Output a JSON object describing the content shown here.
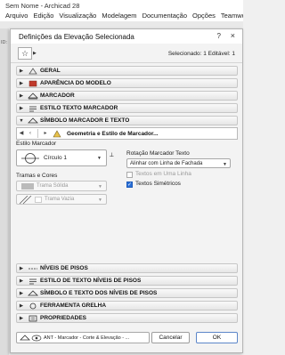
{
  "app": {
    "title": "Sem Nome - Archicad 28",
    "menu": [
      "Arquivo",
      "Edição",
      "Visualização",
      "Modelagem",
      "Documentação",
      "Opções",
      "Teamwork"
    ],
    "left_strip_label": "ID:"
  },
  "dialog": {
    "title": "Definições da Elevação Selecionada",
    "help_icon": "?",
    "close_icon": "×",
    "favorites_icon": "☆",
    "selection_info": "Selecionado: 1 Editável: 1",
    "panels_top": [
      {
        "label": "GERAL",
        "expanded": false
      },
      {
        "label": "APARÊNCIA DO MODELO",
        "expanded": false
      },
      {
        "label": "MARCADOR",
        "expanded": false
      },
      {
        "label": "ESTILO TEXTO MARCADOR",
        "expanded": false
      },
      {
        "label": "SÍMBOLO MARCADOR E TEXTO",
        "expanded": true
      }
    ],
    "subpanel": {
      "label": "Geometria e Estilo de Marcador..."
    },
    "marker_style_label": "Estilo Marcador",
    "marker_style_value": "Círculo 1",
    "rotation_label": "Rotação Marcador Texto",
    "rotation_value": "Alinhar com Linha de Fachada",
    "checkbox_one_line": {
      "label": "Textos em Uma Linha",
      "checked": false,
      "enabled": false
    },
    "checkbox_symmetric": {
      "label": "Textos Simétricos",
      "checked": true,
      "enabled": true
    },
    "hatch_label": "Tramas e Cores",
    "hatch_solid": "Trama Sólida",
    "hatch_empty": "Trama Vazia",
    "panels_bottom": [
      {
        "label": "NÍVEIS DE PISOS"
      },
      {
        "label": "ESTILO DE TEXTO NÍVEIS DE PISOS"
      },
      {
        "label": "SÍMBOLO E TEXTO DOS NÍVEIS DE PISOS"
      },
      {
        "label": "FERRAMENTA GRELHA"
      },
      {
        "label": "PROPRIEDADES"
      }
    ],
    "footer_layer": "ANT - Marcador - Corte & Elevação - ...",
    "cancel_label": "Cancelar",
    "ok_label": "OK"
  },
  "colors": {
    "accent": "#2a6fd6",
    "panel_icon_red": "#c0392b"
  }
}
